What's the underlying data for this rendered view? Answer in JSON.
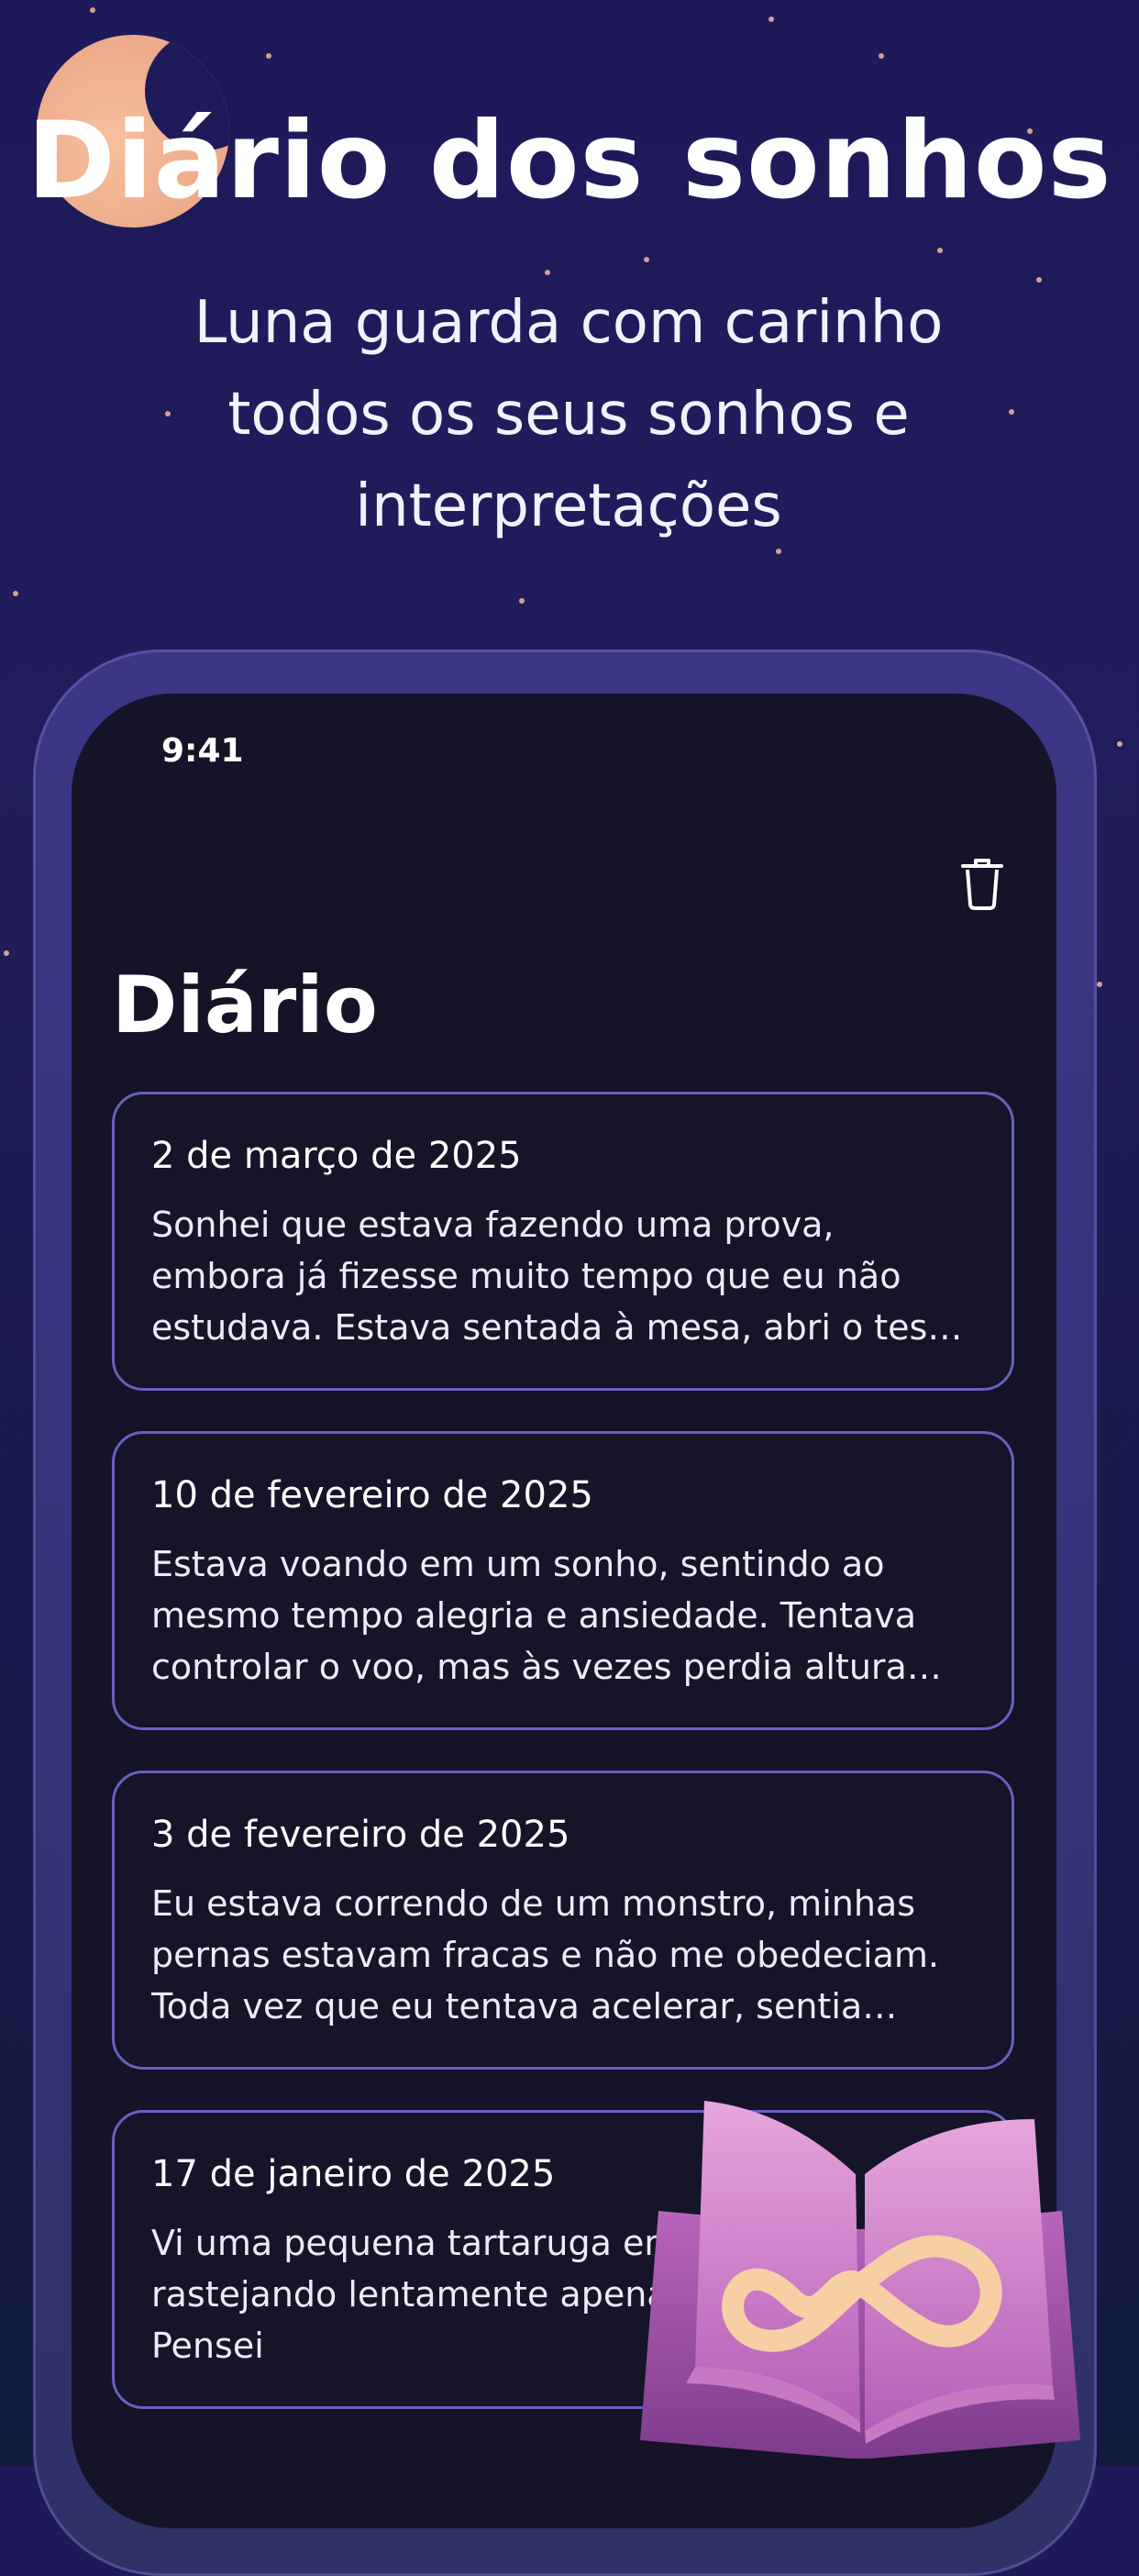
{
  "header": {
    "title": "Diário dos sonhos",
    "subtitle": "Luna guarda com carinho todos os seus sonhos e interpretações"
  },
  "phone": {
    "status_time": "9:41",
    "screen_title": "Diário",
    "entries": [
      {
        "date": "2 de março de 2025",
        "text": "Sonhei que estava fazendo uma prova, embora já fizesse muito tempo que eu não estudava. Estava sentada à mesa, abri o teste e logo sen…"
      },
      {
        "date": "10 de fevereiro de 2025",
        "text": "Estava voando em um sonho, sentindo ao mesmo tempo alegria e ansiedade. Tentava controlar o voo, mas às vezes perdia altura ou,…"
      },
      {
        "date": "3 de fevereiro de 2025",
        "text": "Eu estava correndo de um monstro, minhas pernas estavam fracas e não me obedeciam. Toda vez que eu tentava acelerar, sentia como…"
      },
      {
        "date": "17 de janeiro de 2025",
        "text": "Vi uma pequena tartaruga em estava rastejando lentamente apenas a observava. Pensei"
      }
    ]
  },
  "icons": {
    "moon": "moon-icon",
    "trash": "trash-icon",
    "book": "infinity-book-icon"
  },
  "colors": {
    "background": "#1e1a5a",
    "moon": "#f1ab89",
    "card_border": "#6a5fc0",
    "screen": "#141328"
  }
}
